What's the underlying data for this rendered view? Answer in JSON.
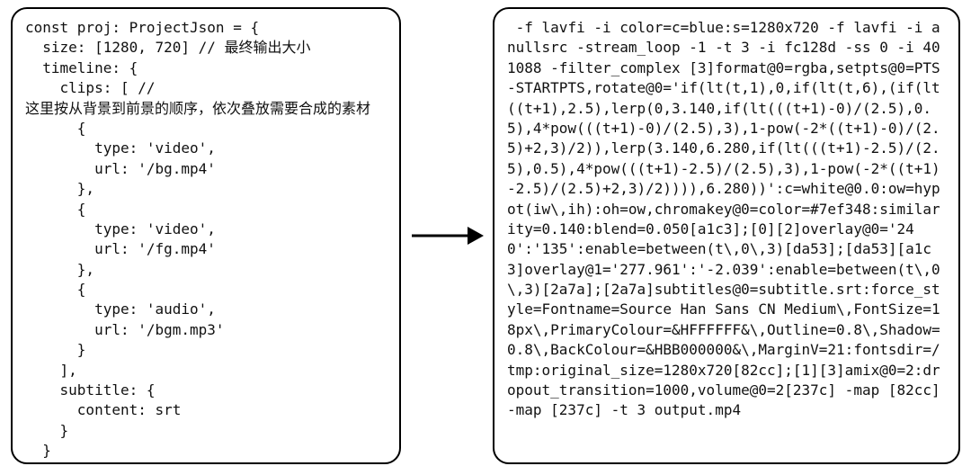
{
  "left_pane": {
    "code": "const proj: ProjectJson = {\n  size: [1280, 720] // 最终输出大小\n  timeline: {\n    clips: [ //\n这里按从背景到前景的顺序，依次叠放需要合成的素材\n      {\n        type: 'video',\n        url: '/bg.mp4'\n      },\n      {\n        type: 'video',\n        url: '/fg.mp4'\n      },\n      {\n        type: 'audio',\n        url: '/bgm.mp3'\n      }\n    ],\n    subtitle: {\n      content: srt\n    }\n  }\n}"
  },
  "right_pane": {
    "command": " -f lavfi -i color=c=blue:s=1280x720 -f lavfi -i anullsrc -stream_loop -1 -t 3 -i fc128d -ss 0 -i 401088 -filter_complex [3]format@0=rgba,setpts@0=PTS-STARTPTS,rotate@0='if(lt(t,1),0,if(lt(t,6),(if(lt((t+1),2.5),lerp(0,3.140,if(lt(((t+1)-0)/(2.5),0.5),4*pow(((t+1)-0)/(2.5),3),1-pow(-2*((t+1)-0)/(2.5)+2,3)/2)),lerp(3.140,6.280,if(lt(((t+1)-2.5)/(2.5),0.5),4*pow(((t+1)-2.5)/(2.5),3),1-pow(-2*((t+1)-2.5)/(2.5)+2,3)/2)))),6.280))':c=white@0.0:ow=hypot(iw\\,ih):oh=ow,chromakey@0=color=#7ef348:similarity=0.140:blend=0.050[a1c3];[0][2]overlay@0='240':'135':enable=between(t\\,0\\,3)[da53];[da53][a1c3]overlay@1='277.961':'-2.039':enable=between(t\\,0\\,3)[2a7a];[2a7a]subtitles@0=subtitle.srt:force_style=Fontname=Source Han Sans CN Medium\\,FontSize=18px\\,PrimaryColour=&HFFFFFF&\\,Outline=0.8\\,Shadow=0.8\\,BackColour=&HBB000000&\\,MarginV=21:fontsdir=/tmp:original_size=1280x720[82cc];[1][3]amix@0=2:dropout_transition=1000,volume@0=2[237c] -map [82cc] -map [237c] -t 3 output.mp4"
  }
}
